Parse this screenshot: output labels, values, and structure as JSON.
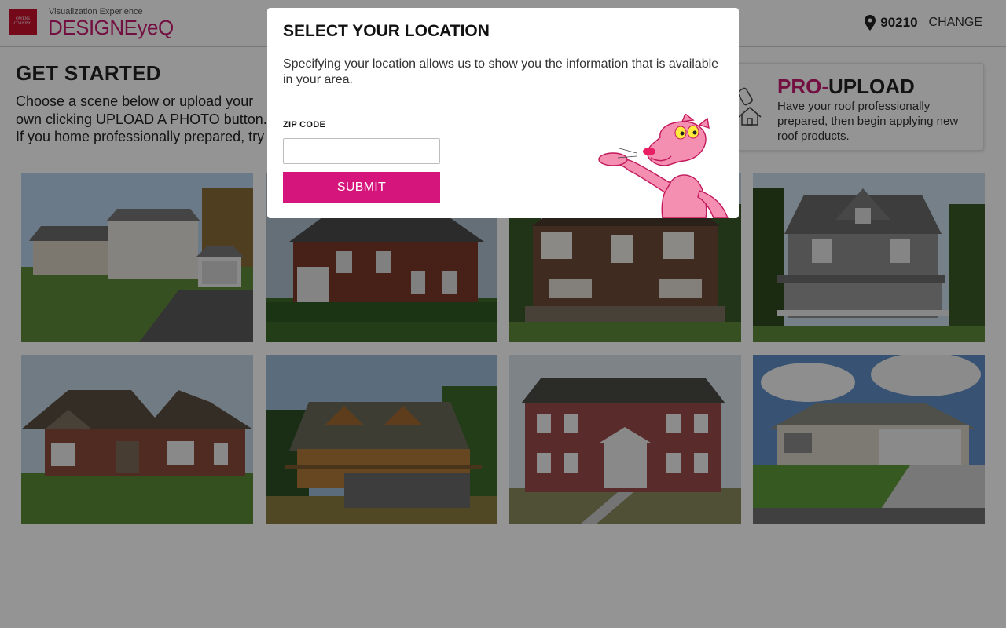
{
  "header": {
    "brand_badge": "OWENS CORNING",
    "brand_sub": "Visualization Experience",
    "brand_main": "DESIGNEyeQ",
    "location_icon": "location-pin-icon",
    "zip": "90210",
    "change_label": "CHANGE"
  },
  "main": {
    "title": "GET STARTED",
    "intro": "Choose a scene below or upload your own clicking UPLOAD A PHOTO button. If you home professionally prepared, try PRO-U"
  },
  "pro_upload": {
    "icon": "house-upload-icon",
    "title_accent": "PRO-",
    "title_rest": "UPLOAD",
    "description": "Have your roof professionally prepared, then begin applying new roof products."
  },
  "scenes": [
    {
      "name": "Split-level house"
    },
    {
      "name": "Brick two-story"
    },
    {
      "name": "Tudor house"
    },
    {
      "name": "Gray Victorian"
    },
    {
      "name": "Brick craftsman"
    },
    {
      "name": "Cedar lodge"
    },
    {
      "name": "Colonial brick"
    },
    {
      "name": "Ranch house"
    }
  ],
  "modal": {
    "title": "SELECT YOUR LOCATION",
    "description": "Specifying your location allows us to show you the information that is available in your area.",
    "zip_label": "ZIP CODE",
    "zip_value": "",
    "submit_label": "SUBMIT",
    "mascot": "pink-panther-mascot"
  },
  "colors": {
    "accent": "#d5147c",
    "brand": "#c61b6f",
    "overlay": "rgba(0,0,0,0.42)"
  }
}
